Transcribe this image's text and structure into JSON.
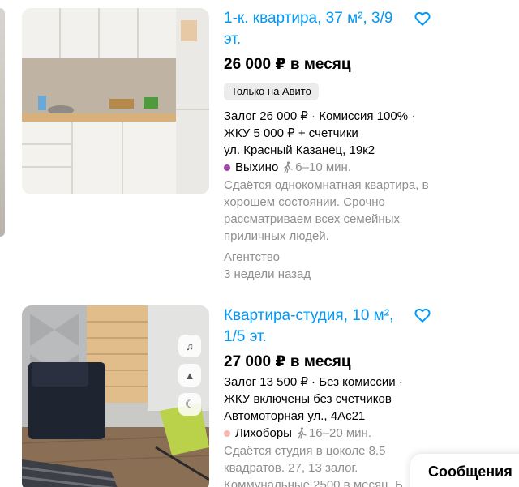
{
  "listings": [
    {
      "title": "1-к. квартира, 37 м², 3/9 эт.",
      "price": "26 000 ₽ в месяц",
      "badge": "Только на Авито",
      "deposit_line": "Залог 26 000 ₽ · Комиссия 100% ·",
      "utilities_line": "ЖКУ 5 000 ₽ + счетчики",
      "address": "ул. Красный Казанец, 19к2",
      "metro": {
        "station": "Выхино",
        "walk": "6–10 мин.",
        "color": "#a24ca8"
      },
      "description": "Сдаётся однокомнатная квартира, в хорошем состоянии. Срочно рассматриваем всех семейных приличных людей.",
      "seller": "Агентство",
      "posted": "3 недели назад"
    },
    {
      "title": "Квартира-студия, 10 м², 1/5 эт.",
      "price": "27 000 ₽ в месяц",
      "deposit_line": "Залог 13 500 ₽ · Без комиссии ·",
      "utilities_line": "ЖКУ включены без счетчиков",
      "address": "Автомоторная ул., 4Ас21",
      "metro": {
        "station": "Лихоборы",
        "walk": "16–20 мин.",
        "color": "#f5b7b0"
      },
      "description": "Сдаётся студия в цоколе 8.5 квадратов. 27, 13 залог. Коммунальные 2500 в месяц. Б"
    }
  ],
  "messages_label": "Сообщения",
  "colors": {
    "link": "#0099f7",
    "muted": "#8f8f8f",
    "badge_bg": "#ececec"
  }
}
